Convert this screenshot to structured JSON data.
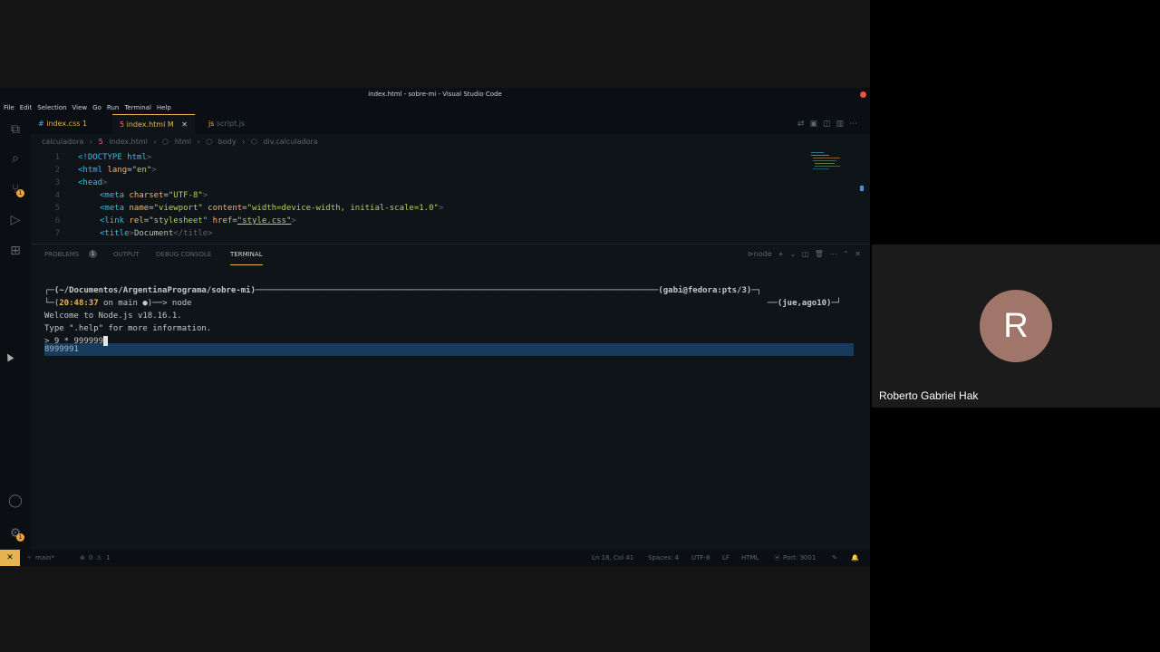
{
  "window": {
    "title": "index.html - sobre-mi - Visual Studio Code"
  },
  "menu": [
    "File",
    "Edit",
    "Selection",
    "View",
    "Go",
    "Run",
    "Terminal",
    "Help"
  ],
  "activity": {
    "scm_badge": "1",
    "settings_badge": "1"
  },
  "tabs": [
    {
      "label": "index.css",
      "badge": "1",
      "color": "#e6b450"
    },
    {
      "label": "index.html",
      "badge": "M",
      "color": "#e6b450"
    },
    {
      "label": "script.js",
      "badge": "",
      "color": "#5c6773"
    }
  ],
  "breadcrumb": [
    "calculadora",
    "index.html",
    "html",
    "body",
    "div.calculadora"
  ],
  "editor": {
    "line_numbers": [
      "1",
      "2",
      "3",
      "4",
      "5",
      "6",
      "7"
    ],
    "lines": [
      {
        "tag_open": "<!DOCTYPE html",
        "rest": ">"
      },
      {
        "tag_open": "<html",
        "attr": "lang",
        "value": "\"en\"",
        "rest": ">"
      },
      {
        "tag_open": "<head",
        "rest": ">"
      },
      {
        "tag_open": "<meta",
        "attr": "charset",
        "value": "\"UTF-8\"",
        "rest": ">"
      },
      {
        "tag_open": "<meta",
        "attr": "name",
        "value": "\"viewport\"",
        "attr2": "content",
        "value2": "\"width=device-width, initial-scale=1.0\"",
        "rest": ">"
      },
      {
        "tag_open": "<link",
        "attr": "rel",
        "value": "\"stylesheet\"",
        "attr2": "href",
        "value2": "\"style.css\"",
        "rest": ">"
      },
      {
        "tag_open": "<title",
        "text": "Document",
        "tag_close": "</title>"
      }
    ]
  },
  "panel": {
    "tabs": [
      "PROBLEMS",
      "OUTPUT",
      "DEBUG CONSOLE",
      "TERMINAL"
    ],
    "problems_badge": "1",
    "shell_label": "node"
  },
  "terminal": {
    "prompt_path": "(~/Documentos/ArgentinaPrograma/sobre-mi)",
    "prompt_user": "(gabi@fedora:pts/3)",
    "prompt_time": "20:48:37",
    "prompt_branch": " on main ●)──> node",
    "prompt_date": "(jue,ago10)",
    "line_welcome": "Welcome to Node.js v18.16.1.",
    "line_help": "Type \".help\" for more information.",
    "line_input": "> 9 * 999999",
    "line_output": "8999991"
  },
  "status": {
    "branch": "main*",
    "errors": "0",
    "warnings": "1",
    "position": "Ln 18, Col 41",
    "spaces": "Spaces: 4",
    "encoding": "UTF-8",
    "eol": "LF",
    "language": "HTML",
    "port": "Port: 3001"
  },
  "participant": {
    "initial": "R",
    "name": "Roberto Gabriel Hak",
    "avatar_color": "#a0766a"
  }
}
